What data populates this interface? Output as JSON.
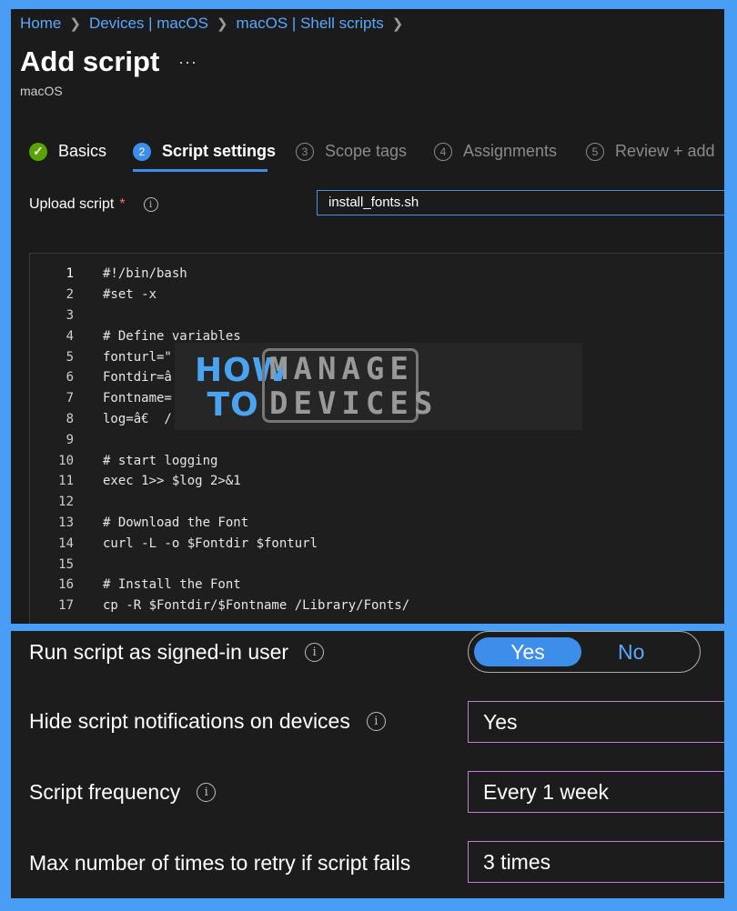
{
  "breadcrumb": [
    "Home",
    "Devices | macOS",
    "macOS | Shell scripts"
  ],
  "page": {
    "title": "Add script",
    "more": "···",
    "subtitle": "macOS"
  },
  "steps": [
    {
      "num": "✓",
      "label": "Basics",
      "state": "done"
    },
    {
      "num": "2",
      "label": "Script settings",
      "state": "active"
    },
    {
      "num": "3",
      "label": "Scope tags",
      "state": "pending"
    },
    {
      "num": "4",
      "label": "Assignments",
      "state": "pending"
    },
    {
      "num": "5",
      "label": "Review + add",
      "state": "pending"
    }
  ],
  "upload": {
    "label": "Upload script",
    "required": "*",
    "value": "install_fonts.sh"
  },
  "code_lines": [
    "#!/bin/bash",
    "#set -x",
    "",
    "# Define variables",
    "fonturl=\"",
    "Fontdir=â",
    "Fontname=",
    "log=â€  /",
    "",
    "# start logging",
    "exec 1>> $log 2>&1",
    "",
    "# Download the Font",
    "curl -L -o $Fontdir $fonturl",
    "",
    "# Install the Font",
    "cp -R $Fontdir/$Fontname /Library/Fonts/"
  ],
  "logo": {
    "how": "HOW",
    "to": "TO",
    "manage": "MANAGE",
    "devices": "DEVICES"
  },
  "settings": {
    "run_as_user": {
      "label": "Run script as signed-in user",
      "yes": "Yes",
      "no": "No",
      "selected": "Yes"
    },
    "hide_notifications": {
      "label": "Hide script notifications on devices",
      "value": "Yes"
    },
    "frequency": {
      "label": "Script frequency",
      "value": "Every 1 week"
    },
    "retry": {
      "label": "Max number of times to retry if script fails",
      "value": "3 times"
    }
  },
  "colors": {
    "accent": "#3d8eea",
    "success": "#57a300",
    "select_border": "#c57bd8",
    "background": "#1b1b1b"
  },
  "icons": {
    "info": "info-circle-icon",
    "check": "checkmark-icon",
    "chevron": "chevron-right-icon"
  }
}
